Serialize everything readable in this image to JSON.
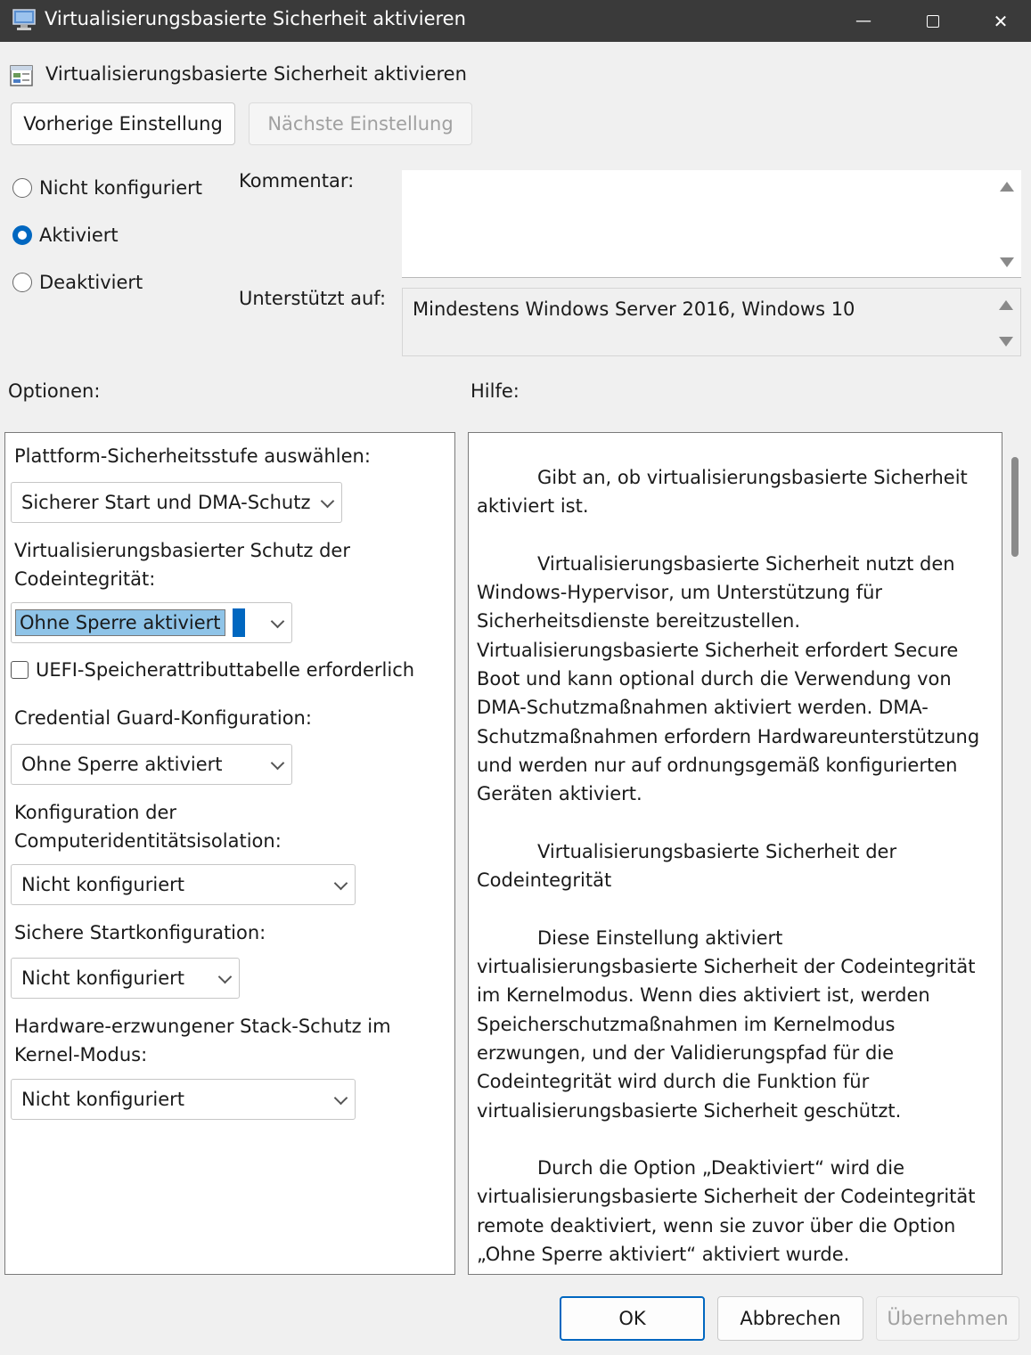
{
  "window": {
    "title": "Virtualisierungsbasierte Sicherheit aktivieren",
    "minimize_glyph": "—",
    "maximize_glyph": "☐",
    "close_glyph": "✕"
  },
  "policy": {
    "title": "Virtualisierungsbasierte Sicherheit aktivieren",
    "prev_button": "Vorherige Einstellung",
    "next_button": "Nächste Einstellung"
  },
  "state": {
    "options": [
      {
        "label": "Nicht konfiguriert",
        "checked": false
      },
      {
        "label": "Aktiviert",
        "checked": true
      },
      {
        "label": "Deaktiviert",
        "checked": false
      }
    ]
  },
  "comment": {
    "label": "Kommentar:",
    "value": ""
  },
  "supported": {
    "label": "Unterstützt auf:",
    "value": "Mindestens Windows Server 2016, Windows 10"
  },
  "sections": {
    "options_label": "Optionen:",
    "help_label": "Hilfe:"
  },
  "options": {
    "platform_label": "Plattform-Sicherheitsstufe auswählen:",
    "platform_value": "Sicherer Start und DMA-Schutz",
    "codeint_label": "Virtualisierungsbasierter Schutz der Codeintegrität:",
    "codeint_value": "Ohne Sperre aktiviert",
    "uefi_label": "UEFI-Speicherattributtabelle erforderlich",
    "uefi_checked": false,
    "credguard_label": "Credential Guard-Konfiguration:",
    "credguard_value": "Ohne Sperre aktiviert",
    "machineid_label": "Konfiguration der Computeridentitätsisolation:",
    "machineid_value": "Nicht konfiguriert",
    "securelaunch_label": "Sichere Startkonfiguration:",
    "securelaunch_value": "Nicht konfiguriert",
    "stackprot_label": "Hardware-erzwungener Stack-Schutz im Kernel-Modus:",
    "stackprot_value": "Nicht konfiguriert"
  },
  "help": {
    "p1": "Gibt an, ob virtualisierungsbasierte Sicherheit aktiviert ist.",
    "p2": "Virtualisierungsbasierte Sicherheit nutzt den Windows-Hypervisor, um Unterstützung für Sicherheitsdienste bereitzustellen. Virtualisierungsbasierte Sicherheit erfordert Secure Boot und kann optional durch die Verwendung von DMA-Schutzmaßnahmen aktiviert werden. DMA-Schutzmaßnahmen erfordern Hardwareunterstützung und werden nur auf ordnungsgemäß konfigurierten Geräten aktiviert.",
    "p3": "Virtualisierungsbasierte Sicherheit der Codeintegrität",
    "p4": "Diese Einstellung aktiviert virtualisierungsbasierte Sicherheit der Codeintegrität im Kernelmodus. Wenn dies aktiviert ist, werden Speicherschutzmaßnahmen im Kernelmodus erzwungen, und der Validierungspfad für die Codeintegrität wird durch die Funktion für virtualisierungsbasierte Sicherheit geschützt.",
    "p5": "Durch die Option „Deaktiviert“ wird die virtualisierungsbasierte Sicherheit der Codeintegrität remote deaktiviert, wenn sie zuvor über die Option „Ohne Sperre aktiviert“ aktiviert wurde."
  },
  "footer": {
    "ok": "OK",
    "cancel": "Abbrechen",
    "apply": "Übernehmen"
  }
}
